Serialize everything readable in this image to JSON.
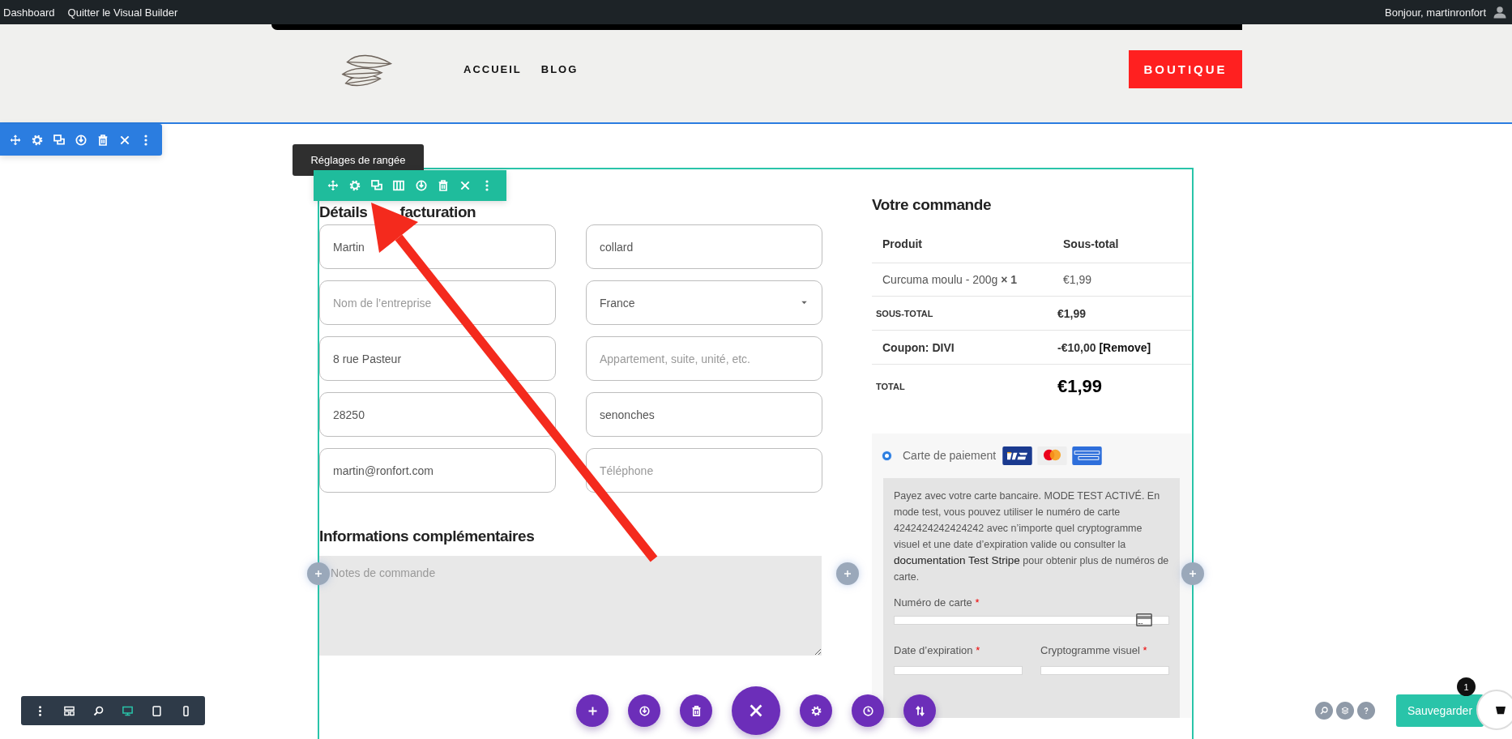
{
  "admin_bar": {
    "links": [
      "Dashboard",
      "Quitter le Visual Builder"
    ],
    "greeting": "Bonjour, martinronfort"
  },
  "header": {
    "nav": [
      "ACCUEIL",
      "BLOG"
    ],
    "button": "BOUTIQUE"
  },
  "tooltip": "Réglages de rangée",
  "billing": {
    "title_parts": [
      "Détails",
      "facturation"
    ],
    "fields": [
      {
        "kind": "text",
        "value": "Martin"
      },
      {
        "kind": "text",
        "value": "collard"
      },
      {
        "kind": "text",
        "placeholder": "Nom de l’entreprise"
      },
      {
        "kind": "select",
        "value": "France"
      },
      {
        "kind": "text",
        "value": "8 rue Pasteur"
      },
      {
        "kind": "text",
        "placeholder": "Appartement, suite, unité, etc."
      },
      {
        "kind": "text",
        "value": "28250"
      },
      {
        "kind": "text",
        "value": "senonches"
      },
      {
        "kind": "text",
        "value": "martin@ronfort.com"
      },
      {
        "kind": "text",
        "placeholder": "Téléphone"
      }
    ]
  },
  "extra": {
    "title": "Informations complémentaires",
    "notes_placeholder": "Notes de commande"
  },
  "order": {
    "title": "Votre commande",
    "columns": [
      "Produit",
      "Sous-total"
    ],
    "item": {
      "name": "Curcuma moulu - 200g **× 1**",
      "price": "€1,99"
    },
    "subtotal": {
      "label": "SOUS-TOTAL",
      "value": "€1,99"
    },
    "coupon": {
      "label": "Coupon: DIVI",
      "value": "-€10,00",
      "link": "[Remove]"
    },
    "total": {
      "label": "TOTAL",
      "value": "€1,99"
    }
  },
  "payment": {
    "method": {
      "label": "Carte de paiement",
      "selected": true
    },
    "description": {
      "before": "Payez avec votre carte bancaire. MODE TEST ACTIVÉ. En mode test, vous pouvez utiliser le numéro de carte 4242424242424242 avec n’importe quel cryptogramme visuel et une date d’expiration valide ou consulter la",
      "link": "documentation Test Stripe",
      "after": "pour obtenir plus de numéros de carte."
    },
    "fields": [
      {
        "label": "Numéro de carte",
        "mark": "*"
      },
      {
        "label": "Date d’expiration",
        "mark": "*"
      },
      {
        "label": "Cryptogramme visuel",
        "mark": "*"
      }
    ]
  },
  "view_modes": [
    {
      "kind": "desktop",
      "selected": true
    },
    {
      "kind": "tablet",
      "selected": false
    },
    {
      "kind": "phone",
      "selected": false
    }
  ],
  "builder": {
    "save": "Sauvegarder",
    "badge": "1"
  }
}
